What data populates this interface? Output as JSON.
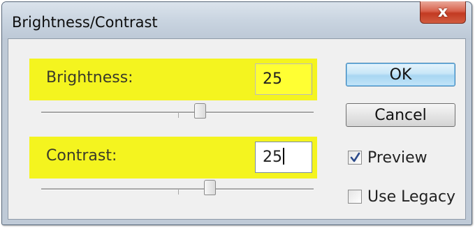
{
  "dialog": {
    "title": "Brightness/Contrast",
    "close_glyph": "x"
  },
  "brightness": {
    "label": "Brightness:",
    "value": "25",
    "slider_fraction": 0.6
  },
  "contrast": {
    "label": "Contrast:",
    "value": "25",
    "slider_fraction": 0.6
  },
  "buttons": {
    "ok_label": "OK",
    "cancel_label": "Cancel"
  },
  "options": {
    "preview_label": "Preview",
    "preview_checked": true,
    "legacy_label": "Use Legacy",
    "legacy_checked": false
  },
  "colors": {
    "highlight": "#f4f41f",
    "close_button": "#c9432a",
    "ok_button": "#a8d6f2"
  },
  "icons": {
    "close": "close-icon",
    "check": "checkmark-icon"
  }
}
